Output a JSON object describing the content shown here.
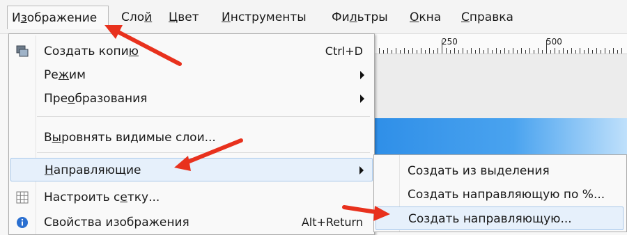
{
  "menubar": {
    "items": [
      {
        "pre": "И",
        "u": "з",
        "post": "ображение"
      },
      {
        "pre": "Сло",
        "u": "й",
        "post": ""
      },
      {
        "pre": "",
        "u": "Ц",
        "post": "вет"
      },
      {
        "pre": "",
        "u": "И",
        "post": "нструменты"
      },
      {
        "pre": "Фи",
        "u": "л",
        "post": "ьтры"
      },
      {
        "pre": "",
        "u": "О",
        "post": "кна"
      },
      {
        "pre": "",
        "u": "С",
        "post": "правка"
      }
    ]
  },
  "ruler": {
    "labels": [
      "250",
      "500"
    ]
  },
  "menu": {
    "items": [
      {
        "pre": "Создать копи",
        "u": "ю",
        "post": "",
        "shortcut": "Ctrl+D"
      },
      {
        "pre": "Ре",
        "u": "ж",
        "post": "им"
      },
      {
        "pre": "Пре",
        "u": "о",
        "post": "бразования"
      },
      {
        "pre": "В",
        "u": "ы",
        "post": "ровнять видимые слои..."
      },
      {
        "pre": "",
        "u": "Н",
        "post": "аправляющие"
      },
      {
        "pre": "Настроить с",
        "u": "е",
        "post": "тку..."
      },
      {
        "pre": "Свойства изображения",
        "u": "",
        "post": "",
        "shortcut": "Alt+Return"
      }
    ]
  },
  "submenu": {
    "items": [
      {
        "pre": "Создать из ",
        "u": "в",
        "post": "ыделения"
      },
      {
        "pre": "Создать на",
        "u": "п",
        "post": "равляющую по %..."
      },
      {
        "pre": "",
        "u": "С",
        "post": "оздать направляющую..."
      }
    ]
  },
  "colors": {
    "accent_arrow": "#e8311d",
    "hover_bg": "#e6f0fb",
    "hover_border": "#a8c8ea"
  },
  "icons": {
    "duplicate": "duplicate-image-icon",
    "grid": "grid-icon",
    "properties": "info-icon"
  }
}
